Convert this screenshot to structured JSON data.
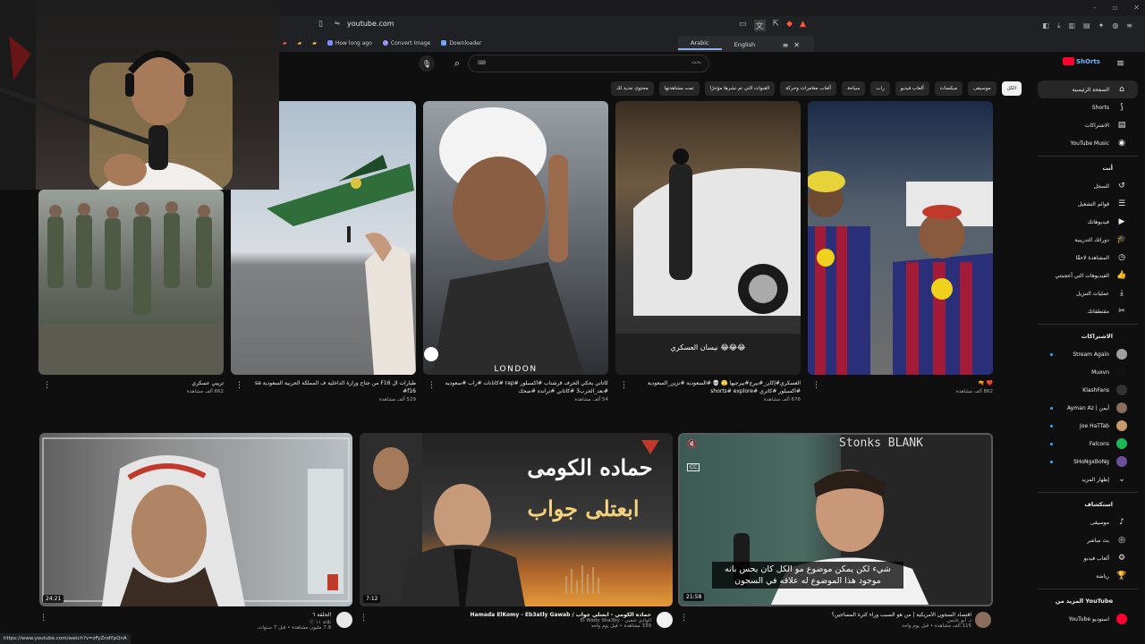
{
  "browser": {
    "url": "youtube.com",
    "bookmarks": [
      {
        "label": "How long ago",
        "color": "#7b8cff"
      },
      {
        "label": "Convert Image",
        "color": "#a98cff"
      },
      {
        "label": "Downloader",
        "color": "#6aa6ff"
      }
    ],
    "translate": {
      "lang_source": "Arabic",
      "lang_target": "English"
    },
    "status_url": "https://www.youtube.com/watch?v=zFyZndYpQnA"
  },
  "search": {
    "placeholder": "بحث",
    "shortcut": "⌨"
  },
  "logo": {
    "text": "ShOrts"
  },
  "chips": [
    "الكل",
    "موسيقى",
    "ميكسات",
    "ألعاب فيديو",
    "راب",
    "سياحة",
    "ألعاب مغامرات وحركة",
    "القنوات التي تم نشرها مؤخرًا",
    "تمت مشاهدتها",
    "محتوى جديد لك"
  ],
  "sidebar": {
    "main": [
      {
        "label": "الصفحة الرئيسية",
        "icon": "⌂"
      },
      {
        "label": "Shorts",
        "icon": "⟆"
      },
      {
        "label": "الاشتراكات",
        "icon": "▤"
      },
      {
        "label": "YouTube Music",
        "icon": "◉"
      }
    ],
    "you_header": "أنت",
    "you": [
      {
        "label": "السجل",
        "icon": "↺"
      },
      {
        "label": "قوائم التشغيل",
        "icon": "☰"
      },
      {
        "label": "فيديوهاتك",
        "icon": "▶"
      },
      {
        "label": "دوراتك التدريبية",
        "icon": "🎓"
      },
      {
        "label": "المشاهدة لاحقًا",
        "icon": "◷"
      },
      {
        "label": "الفيديوهات التي أعجبتني",
        "icon": "👍"
      },
      {
        "label": "عمليات التنزيل",
        "icon": "⤓"
      },
      {
        "label": "مقتطفاتك",
        "icon": "✂"
      }
    ],
    "subs_header": "الاشتراكات",
    "subs": [
      {
        "label": "Stream Again",
        "color": "#a0a0a0",
        "dot": true
      },
      {
        "label": "Muxvn",
        "color": "#111111",
        "dot": false
      },
      {
        "label": "KlashFans",
        "color": "#333333",
        "dot": false
      },
      {
        "label": "Ayman Az | أيمن",
        "color": "#8a6d5a",
        "dot": true
      },
      {
        "label": "Joe HaTTab",
        "color": "#c79a6a",
        "dot": true
      },
      {
        "label": "Falcons",
        "color": "#1db954",
        "dot": true
      },
      {
        "label": "SHoNgxBoNg",
        "color": "#6b4f9a",
        "dot": true
      }
    ],
    "show_more": "إظهار المزيد",
    "explore_header": "استكشاف",
    "explore": [
      {
        "label": "موسيقى",
        "icon": "♪"
      },
      {
        "label": "بث مباشر",
        "icon": "◎"
      },
      {
        "label": "ألعاب فيديو",
        "icon": "⚙"
      },
      {
        "label": "رياضة",
        "icon": "🏆"
      }
    ],
    "more_header": "المزيد من YouTube",
    "more": [
      {
        "label": "YouTube استوديو",
        "color": "#ff0033"
      }
    ]
  },
  "shorts": [
    {
      "title": "تريبي عسكري",
      "views": "662 ألف مشاهدة"
    },
    {
      "title": "طيارات ال F16 من جناح وزارة الداخلية ف المملكة الحربية السعودية sa #f16",
      "views": "529 ألف مشاهدة"
    },
    {
      "title": "كاتاني يحكي الحرف قرشناب #اكسبلور #rap #كاتانات #راب #سعوديه #بعد_الحرب3 #كاتاني #ترانده #ضحك",
      "views": "54 ألف مشاهدة"
    },
    {
      "title": "العسكري#إكان_#بيرج#بيرجيها 🫣 💀 #السعودية #نزين_السعودية #اكسبلور #كاتري #shorts# explore",
      "views": "676 ألف مشاهدة"
    },
    {
      "title": "❤️ 🔫",
      "views": "862 ألف مشاهدة"
    }
  ],
  "short_overlays": {
    "london": "LONDON",
    "nissan": "😂😂😂 نيسان العسكري"
  },
  "videos": [
    {
      "title": "الحلقة ٦",
      "channel": "ثلاثة ١١ ⓥ",
      "views": "7.9 مليون مشاهدة • قبل 7 سنوات",
      "duration": "24:21"
    },
    {
      "title": "Hamada ElKomy - Eb3atly Gawab / حماده الكومي - ابعتلي جواب",
      "channel": "El Wady Sha3by - الوادي شعبي",
      "views": "339 مشاهدة • قبل يوم واحد",
      "duration": "7:12",
      "thumb_title": "حماده الكومى",
      "thumb_sub": "ابعتلى جواب"
    },
    {
      "title": "اقتصاد السجون الأمريكية | من هو السبب وراء كثرة المساجين؟",
      "channel": "د. أبو عابس",
      "views": "115 ألف مشاهدة • قبل يوم واحد",
      "duration": "21:58",
      "caption": "شيء لكن يمكن موضوع مو الكل كان يحس بانه موجود هذا الموضوع له علاقه في السجون",
      "board": "Stonks BLANK"
    }
  ]
}
